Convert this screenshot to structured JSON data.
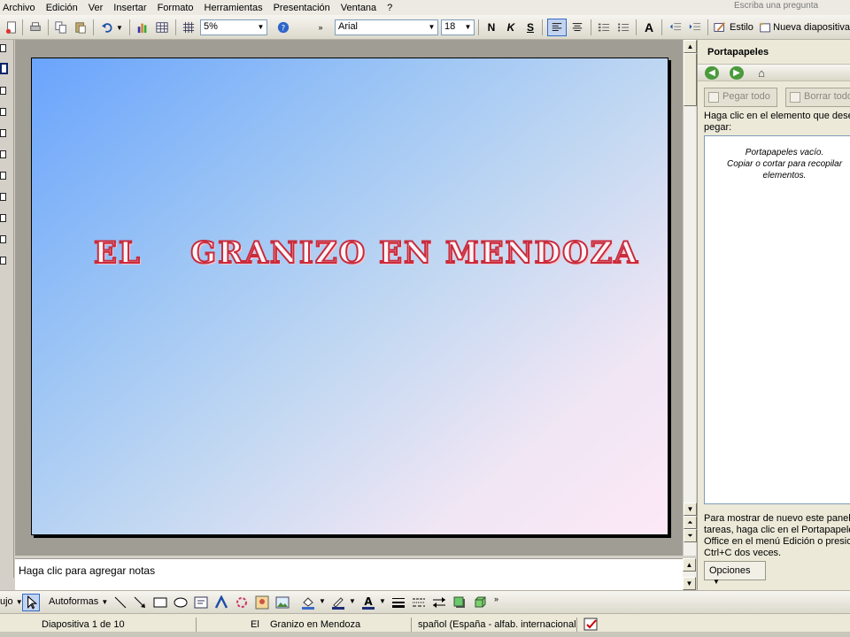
{
  "menubar": {
    "items": [
      "Archivo",
      "Edición",
      "Ver",
      "Insertar",
      "Formato",
      "Herramientas",
      "Presentación",
      "Ventana",
      "?"
    ],
    "ask_placeholder": "Escriba una pregunta"
  },
  "toolbar": {
    "zoom_value": "5%",
    "font_name": "Arial",
    "font_size": "18",
    "bold_label": "N",
    "italic_label": "K",
    "underline_label": "S",
    "design_label": "Estilo",
    "new_slide_label": "Nueva diapositiva"
  },
  "slide": {
    "title": "EL    GRANIZO EN MENDOZA"
  },
  "notes": {
    "placeholder": "Haga clic para agregar notas"
  },
  "taskpane": {
    "title": "Portapapeles",
    "paste_all_label": "Pegar todo",
    "clear_all_label": "Borrar todo",
    "instructions_line1": "Haga clic en el elemento que desea",
    "instructions_line2": "pegar:",
    "empty_line1": "Portapapeles vacío.",
    "empty_line2": "Copiar o cortar para recopilar",
    "empty_line3": "elementos.",
    "bottom_line1": "Para mostrar de nuevo este panel",
    "bottom_line2": "tareas, haga clic en el Portapapeles",
    "bottom_line3": "Office en el menú Edición o presione",
    "bottom_line4": "Ctrl+C dos veces.",
    "options_label": "Opciones"
  },
  "drawbar": {
    "draw_label": "ujo",
    "autoshapes_label": "Autoformas"
  },
  "statusbar": {
    "slide_counter": "Diapositiva 1 de 10",
    "design_name": "El    Granizo en Mendoza",
    "language": "spañol (España - alfab. internacional"
  }
}
